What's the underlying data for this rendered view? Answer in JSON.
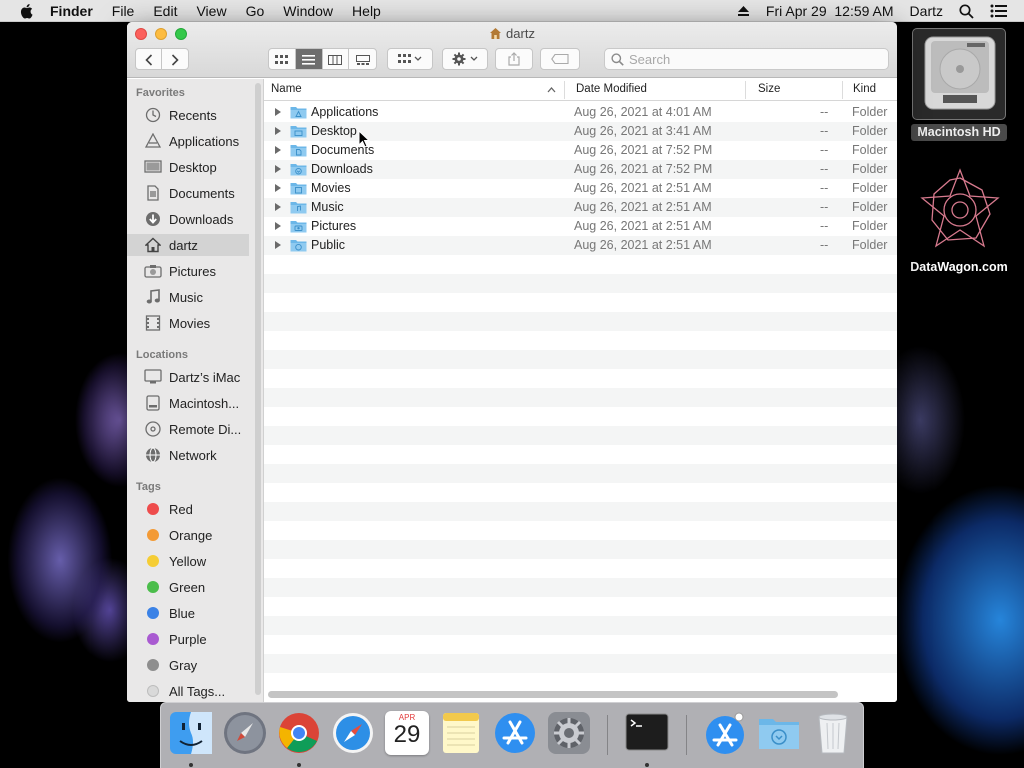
{
  "menubar": {
    "app_name": "Finder",
    "menus": [
      "File",
      "Edit",
      "View",
      "Go",
      "Window",
      "Help"
    ],
    "clock": "Fri Apr 29  12:59 AM",
    "user": "Dartz"
  },
  "desktop": {
    "drive_label": "Macintosh HD",
    "logo_label": "DataWagon.com"
  },
  "window": {
    "title": "dartz",
    "search_placeholder": "Search"
  },
  "sidebar": {
    "favorites_header": "Favorites",
    "favorites": [
      {
        "label": "Recents",
        "icon": "clock-icon"
      },
      {
        "label": "Applications",
        "icon": "applications-icon"
      },
      {
        "label": "Desktop",
        "icon": "desktop-icon"
      },
      {
        "label": "Documents",
        "icon": "documents-icon"
      },
      {
        "label": "Downloads",
        "icon": "downloads-icon"
      },
      {
        "label": "dartz",
        "icon": "home-icon",
        "selected": true
      },
      {
        "label": "Pictures",
        "icon": "camera-icon"
      },
      {
        "label": "Music",
        "icon": "music-icon"
      },
      {
        "label": "Movies",
        "icon": "film-icon"
      }
    ],
    "locations_header": "Locations",
    "locations": [
      {
        "label": "Dartz’s iMac",
        "icon": "imac-icon"
      },
      {
        "label": "Macintosh...",
        "icon": "disk-icon"
      },
      {
        "label": "Remote Di...",
        "icon": "optical-disc-icon"
      },
      {
        "label": "Network",
        "icon": "network-icon"
      }
    ],
    "tags_header": "Tags",
    "tags": [
      {
        "label": "Red",
        "color": "#ee4c4c"
      },
      {
        "label": "Orange",
        "color": "#f39a35"
      },
      {
        "label": "Yellow",
        "color": "#f5cd35"
      },
      {
        "label": "Green",
        "color": "#4bbd4b"
      },
      {
        "label": "Blue",
        "color": "#3b82e6"
      },
      {
        "label": "Purple",
        "color": "#a95ad1"
      },
      {
        "label": "Gray",
        "color": "#8e8e8e"
      },
      {
        "label": "All Tags...",
        "color": "#d9d9d9"
      }
    ]
  },
  "list": {
    "columns": {
      "name": "Name",
      "date": "Date Modified",
      "size": "Size",
      "kind": "Kind"
    },
    "rows": [
      {
        "name": "Applications",
        "date": "Aug 26, 2021 at 4:01 AM",
        "size": "--",
        "kind": "Folder"
      },
      {
        "name": "Desktop",
        "date": "Aug 26, 2021 at 3:41 AM",
        "size": "--",
        "kind": "Folder"
      },
      {
        "name": "Documents",
        "date": "Aug 26, 2021 at 7:52 PM",
        "size": "--",
        "kind": "Folder"
      },
      {
        "name": "Downloads",
        "date": "Aug 26, 2021 at 7:52 PM",
        "size": "--",
        "kind": "Folder"
      },
      {
        "name": "Movies",
        "date": "Aug 26, 2021 at 2:51 AM",
        "size": "--",
        "kind": "Folder"
      },
      {
        "name": "Music",
        "date": "Aug 26, 2021 at 2:51 AM",
        "size": "--",
        "kind": "Folder"
      },
      {
        "name": "Pictures",
        "date": "Aug 26, 2021 at 2:51 AM",
        "size": "--",
        "kind": "Folder"
      },
      {
        "name": "Public",
        "date": "Aug 26, 2021 at 2:51 AM",
        "size": "--",
        "kind": "Folder"
      }
    ]
  },
  "dock": {
    "calendar_month": "APR",
    "calendar_day": "29",
    "items": [
      "finder-icon",
      "launchpad-icon",
      "chrome-icon",
      "safari-icon",
      "calendar-icon",
      "notes-icon",
      "app-store-icon",
      "system-preferences-icon",
      "terminal-icon",
      "app-store-icon",
      "downloads-folder-icon",
      "trash-icon"
    ]
  },
  "colors": {
    "accent": "#3d8ee6",
    "folder": "#6cb7e8"
  }
}
